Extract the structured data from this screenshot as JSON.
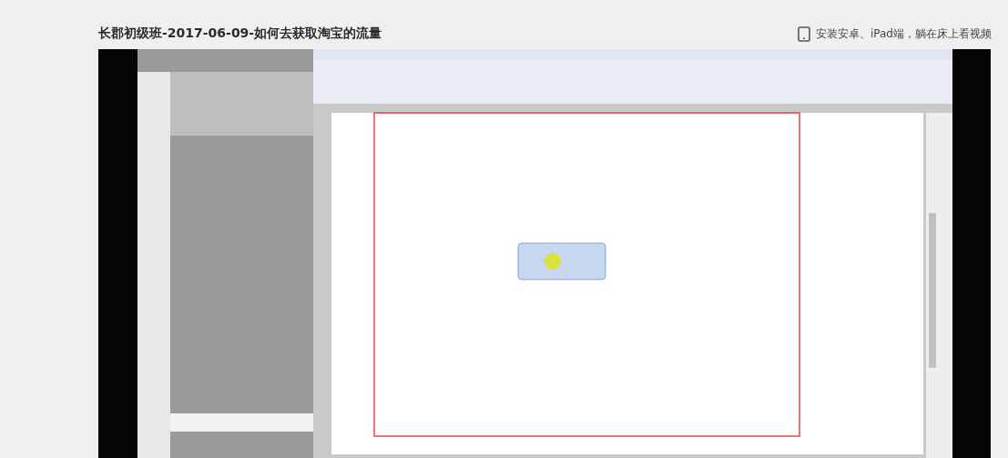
{
  "title": "长郡初级班-2017-06-09-如何去获取淘宝的流量",
  "app_promo": {
    "text": "安装安卓、iPad端，躺在床上看视频"
  }
}
